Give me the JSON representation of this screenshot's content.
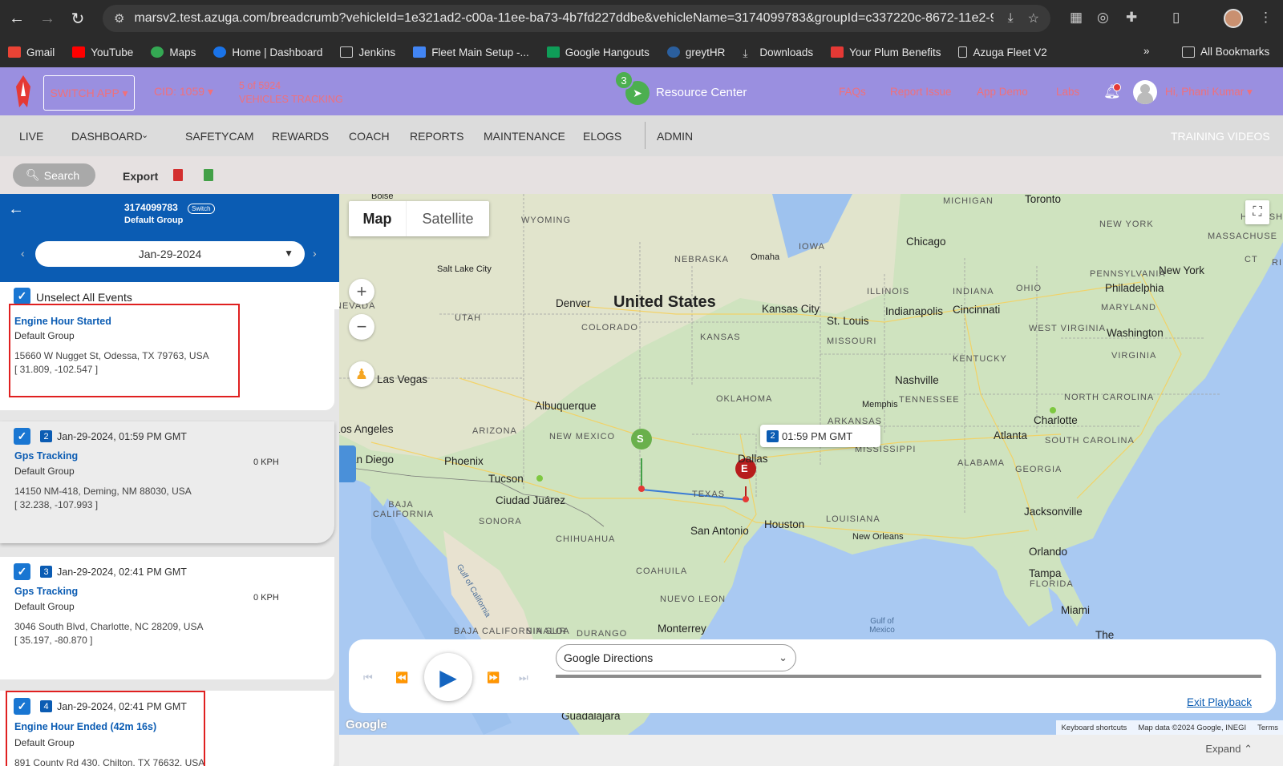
{
  "browser": {
    "url": "marsv2.test.azuga.com/breadcrumb?vehicleId=1e321ad2-c00a-11ee-ba73-4b7fd227ddbe&vehicleName=3174099783&groupId=c337220c-8672-11e2-9b...",
    "bookmarks": [
      "Gmail",
      "YouTube",
      "Maps",
      "Home | Dashboard",
      "Jenkins",
      "Fleet Main Setup -...",
      "Google Hangouts",
      "greytHR",
      "Downloads",
      "Your Plum Benefits",
      "Azuga Fleet V2"
    ],
    "bookmark_more": "»",
    "all_bookmarks": "All Bookmarks"
  },
  "header": {
    "switch_app": "SWITCH APP ▾",
    "cid": "CID: 1059 ▾",
    "vehicles_line1": "5 of 5924",
    "vehicles_line2": "VEHICLES TRACKING",
    "resource_badge": "3",
    "resource_center": "Resource Center",
    "links": [
      "FAQs",
      "Report Issue",
      "App Demo",
      "Labs"
    ],
    "user": "Hi, Phani Kumar ▾"
  },
  "nav": {
    "items": [
      "LIVE",
      "DASHBOARD",
      "SAFETYCAM",
      "REWARDS",
      "COACH",
      "REPORTS",
      "MAINTENANCE",
      "ELOGS",
      "ADMIN"
    ],
    "training": "TRAINING VIDEOS"
  },
  "toolbar": {
    "search": "Search",
    "export": "Export"
  },
  "panel": {
    "vehicle": "3174099783",
    "switch": "Switch",
    "group": "Default Group",
    "date": "Jan-29-2024",
    "unselect": "Unselect All Events"
  },
  "events": [
    {
      "title": "Engine Hour Started",
      "group": "Default Group",
      "address": "15660 W Nugget St, Odessa, TX 79763, USA",
      "coords": "[ 31.809, -102.547 ]"
    },
    {
      "num": "2",
      "time": "Jan-29-2024, 01:59 PM GMT",
      "title": "Gps Tracking",
      "group": "Default Group",
      "speed": "0 KPH",
      "address": "14150 NM-418, Deming, NM 88030, USA",
      "coords": "[ 32.238, -107.993 ]"
    },
    {
      "num": "3",
      "time": "Jan-29-2024, 02:41 PM GMT",
      "title": "Gps Tracking",
      "group": "Default Group",
      "speed": "0 KPH",
      "address": "3046 South Blvd, Charlotte, NC 28209, USA",
      "coords": "[ 35.197, -80.870 ]"
    },
    {
      "num": "4",
      "time": "Jan-29-2024, 02:41 PM GMT",
      "title": "Engine Hour Ended (42m 16s)",
      "group": "Default Group",
      "address": "891 County Rd 430, Chilton, TX 76632, USA"
    }
  ],
  "map": {
    "tab_map": "Map",
    "tab_satellite": "Satellite",
    "tooltip_num": "2",
    "tooltip_time": "01:59 PM GMT",
    "marker_start": "S",
    "marker_end": "E",
    "country": "United States",
    "labels": [
      "Toronto",
      "MICHIGAN",
      "Chicago",
      "NEW YORK",
      "MASSACHUSE",
      "New York",
      "IOWA",
      "NEBRASKA",
      "Omaha",
      "WYOMING",
      "Salt Lake City",
      "Denver",
      "UTAH",
      "COLORADO",
      "Kansas City",
      "St. Louis",
      "Indianapolis",
      "Cincinnati",
      "ILLINOIS",
      "INDIANA",
      "OHIO",
      "PENNSYLVANIA",
      "Philadelphia",
      "MARYLAND",
      "Washington",
      "WEST VIRGINIA",
      "VIRGINIA",
      "KENTUCKY",
      "MISSOURI",
      "KANSAS",
      "Las Vegas",
      "Nashville",
      "TENNESSEE",
      "Memphis",
      "NORTH CAROLINA",
      "Charlotte",
      "SOUTH CAROLINA",
      "Atlanta",
      "ALABAMA",
      "GEORGIA",
      "MISSISSIPPI",
      "ARKANSAS",
      "OKLAHOMA",
      "Albuquerque",
      "ARIZONA",
      "NEW MEXICO",
      "Phoenix",
      "Tucson",
      "Los Angeles",
      "San Diego",
      "Dallas",
      "TEXAS",
      "Ciudad Juárez",
      "BAJA CALIFORNIA",
      "SONORA",
      "CHIHUAHUA",
      "San Antonio",
      "Houston",
      "LOUISIANA",
      "New Orleans",
      "Jacksonville",
      "Orlando",
      "Tampa",
      "FLORIDA",
      "Miami",
      "COAHUILA",
      "NUEVO LEON",
      "Monterrey",
      "Gulf of Mexico",
      "Gulf of California",
      "BAJA CALIFORNIA SUR",
      "SINALOA",
      "DURANGO",
      "Guadalajara",
      "The",
      "Boise",
      "NEVADA",
      "CT",
      "RI",
      "HAMPSHIRE"
    ],
    "keyboard": "Keyboard shortcuts",
    "mapdata": "Map data ©2024 Google, INEGI",
    "terms": "Terms"
  },
  "playback": {
    "directions": "Google Directions",
    "exit": "Exit Playback"
  },
  "footer": {
    "expand": "Expand"
  }
}
